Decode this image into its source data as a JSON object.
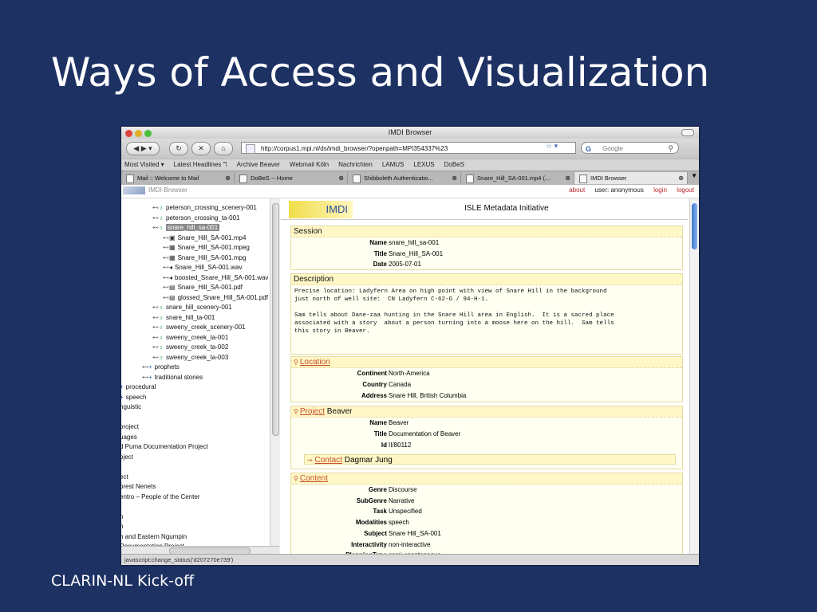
{
  "slide": {
    "title": "Ways of Access and Visualization",
    "footer": "CLARIN-NL Kick-off"
  },
  "browser": {
    "window_title": "IMDI Browser",
    "url": "http://corpus1.mpi.nl/ds/imdi_browser/?openpath=MPI354337%23",
    "search_placeholder": "Google",
    "bookmarks": [
      "Most Visited ▾",
      "Latest Headlines ℸ",
      "Archive Beaver",
      "Webmail Köln",
      "Nachrichten",
      "LAMUS",
      "LEXUS",
      "DoBeS"
    ],
    "tabs": [
      {
        "label": "Mail :: Welcome to Mail"
      },
      {
        "label": "DoBeS -- Home"
      },
      {
        "label": "Shibboleth Authenticatio..."
      },
      {
        "label": "Snare_Hill_SA-001.mp4 (..."
      },
      {
        "label": "IMDI Browser"
      }
    ],
    "status": "javascript:change_status('d207270e739')"
  },
  "imdi": {
    "app_name": "IMDI-Browser",
    "about": "about",
    "user": "user: anonymous",
    "login": "login",
    "logout": "logout",
    "logo_text": "IMDI",
    "initiative": "ISLE Metadata Initiative"
  },
  "tree": [
    {
      "label": "peterson_crossing_scenery-001",
      "icon": "person-icon"
    },
    {
      "label": "peterson_crossing_ta-001",
      "icon": "person-icon"
    },
    {
      "label": "snare_hill_sa-001",
      "icon": "person-icon",
      "selected": true
    },
    {
      "label": "Snare_Hill_SA-001.mp4",
      "icon": "film-icon"
    },
    {
      "label": "Snare_Hill_SA-001.mpeg",
      "icon": "video-icon"
    },
    {
      "label": "Snare_Hill_SA-001.mpg",
      "icon": "video-icon"
    },
    {
      "label": "Snare_Hill_SA-001.wav",
      "icon": "audio-icon"
    },
    {
      "label": "boosted_Snare_Hill_SA-001.wav",
      "icon": "audio-icon"
    },
    {
      "label": "Snare_Hill_SA-001.pdf",
      "icon": "document-icon"
    },
    {
      "label": "glossed_Snare_Hill_SA-001.pdf",
      "icon": "document-icon"
    },
    {
      "label": "snare_hill_scenery-001",
      "icon": "person-icon"
    },
    {
      "label": "snare_hill_ta-001",
      "icon": "person-icon"
    },
    {
      "label": "sweeny_creek_scenery-001",
      "icon": "person-icon"
    },
    {
      "label": "sweeny_creek_ta-001",
      "icon": "person-icon"
    },
    {
      "label": "sweeny_creek_ta-002",
      "icon": "person-icon"
    },
    {
      "label": "sweeny_creek_ta-003",
      "icon": "person-icon"
    },
    {
      "label": "prophets",
      "icon": "corpus-icon"
    },
    {
      "label": "traditional stories",
      "icon": "corpus-icon"
    },
    {
      "label": "procedural",
      "icon": "corpus-icon"
    },
    {
      "label": "speech",
      "icon": "corpus-icon"
    },
    {
      "label": "nguistic",
      "icon": ""
    },
    {
      "label": "",
      "icon": ""
    },
    {
      "label": "project",
      "icon": ""
    },
    {
      "label": "uages",
      "icon": ""
    },
    {
      "label": "d Puma Documentation Project",
      "icon": ""
    },
    {
      "label": "oject",
      "icon": ""
    },
    {
      "label": "",
      "icon": ""
    },
    {
      "label": "ect",
      "icon": ""
    },
    {
      "label": "orest Nenets",
      "icon": ""
    },
    {
      "label": "entro – People of the Center",
      "icon": ""
    },
    {
      "label": "",
      "icon": ""
    },
    {
      "label": "n",
      "icon": ""
    },
    {
      "label": "n",
      "icon": ""
    },
    {
      "label": "n and Eastern Ngumpin",
      "icon": ""
    },
    {
      "label": "Documentation Project",
      "icon": ""
    }
  ],
  "session": {
    "title": "Session",
    "name_key": "Name",
    "name": "snare_hill_sa-001",
    "title_key": "Title",
    "title_val": "Snare_Hill_SA-001",
    "date_key": "Date",
    "date": "2005-07-01"
  },
  "description": {
    "title": "Description",
    "text": "Precise location: Ladyfern Area on high point with view of Snare Hill in the background\njust north of well site:  CN Ladyfern C-62-G / 94-H-1.\n\nSam tells about Dane-zaa hunting in the Snare Hill area in English.  It is a sacred place\nassociated with a story  about a person turning into a moose here on the hill.  Sam tells\nthis story in Beaver."
  },
  "location": {
    "title": "Location",
    "continent_key": "Continent",
    "continent": "North-America",
    "country_key": "Country",
    "country": "Canada",
    "address_key": "Address",
    "address": "Snare Hill, British Columbia"
  },
  "project": {
    "title": "Project",
    "suffix": "Beaver",
    "name_key": "Name",
    "name": "Beaver",
    "title_key": "Title",
    "title_val": "Documentation of Beaver",
    "id_key": "Id",
    "id": "II/80112",
    "contact_title": "Contact",
    "contact_name": "Dagmar Jung"
  },
  "content": {
    "title": "Content",
    "rows": [
      {
        "key": "Genre",
        "val": "Discourse"
      },
      {
        "key": "SubGenre",
        "val": "Narrative"
      },
      {
        "key": "Task",
        "val": "Unspecified"
      },
      {
        "key": "Modalities",
        "val": "speech"
      },
      {
        "key": "Subject",
        "val": "Snare Hill_SA-001"
      },
      {
        "key": "Interactivity",
        "val": "non-interactive"
      },
      {
        "key": "PlanningType",
        "val": "semi-spontaneous"
      }
    ]
  }
}
